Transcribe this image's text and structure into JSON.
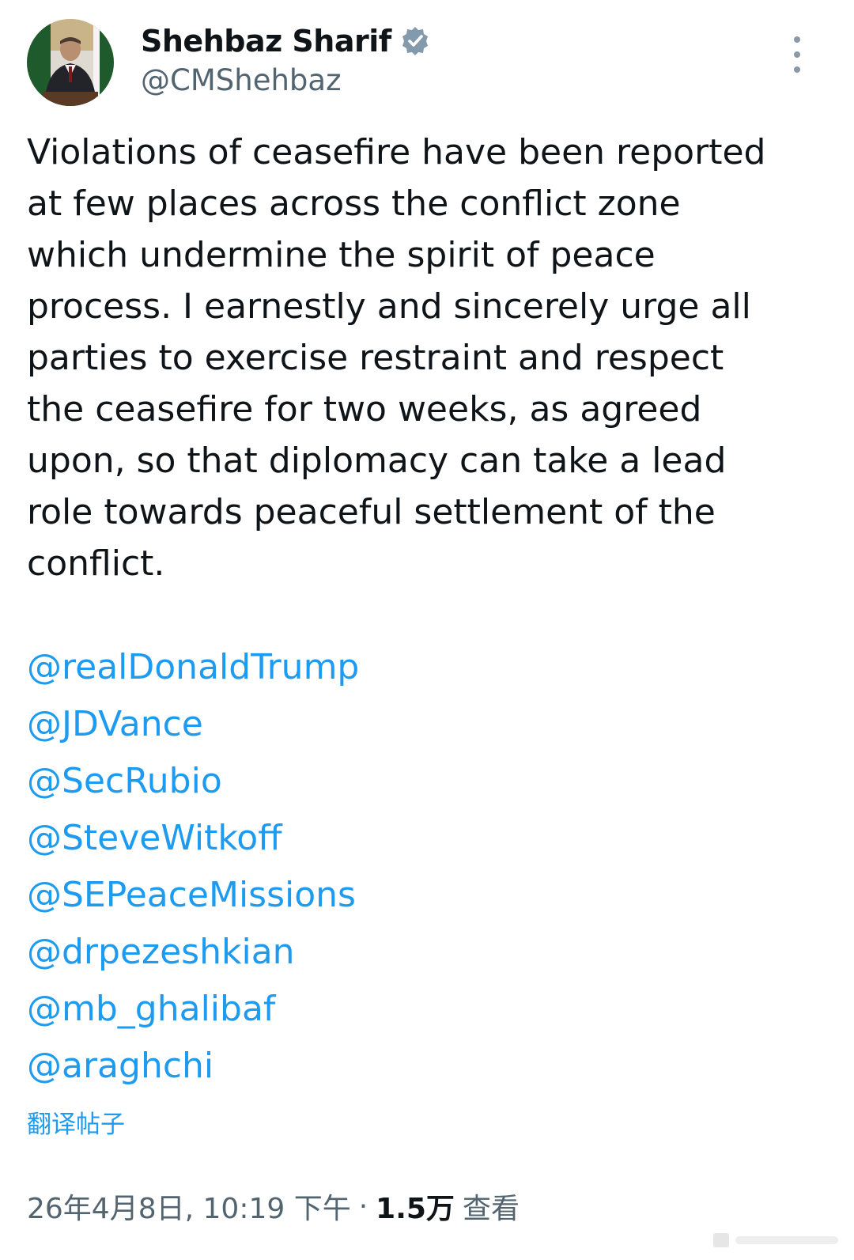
{
  "author": {
    "display_name": "Shehbaz Sharif",
    "handle": "@CMShehbaz",
    "verified_icon": "verified-badge-icon",
    "accent_color": "#1d9bf0"
  },
  "post": {
    "text_lines": [
      "Violations of ceasefire have been reported",
      "at few places across the conflict zone",
      "which undermine the spirit of peace",
      "process. I earnestly and sincerely urge all",
      "parties to exercise restraint and respect",
      "the ceasefire for two weeks, as agreed",
      "upon, so that diplomacy can take a lead",
      "role towards peaceful settlement of the",
      "conflict."
    ],
    "mentions": [
      "@realDonaldTrump",
      "@JDVance",
      "@SecRubio",
      "@SteveWitkoff",
      "@SEPeaceMissions",
      "@drpezeshkian",
      "@mb_ghalibaf",
      "@araghchi"
    ],
    "translate_label": "翻译帖子"
  },
  "meta": {
    "timestamp": "26年4月8日, 10:19 下午",
    "separator": "·",
    "views_count": "1.5万",
    "views_label": "查看"
  },
  "icons": {
    "more": "more-vertical-icon",
    "avatar": "profile-avatar"
  }
}
